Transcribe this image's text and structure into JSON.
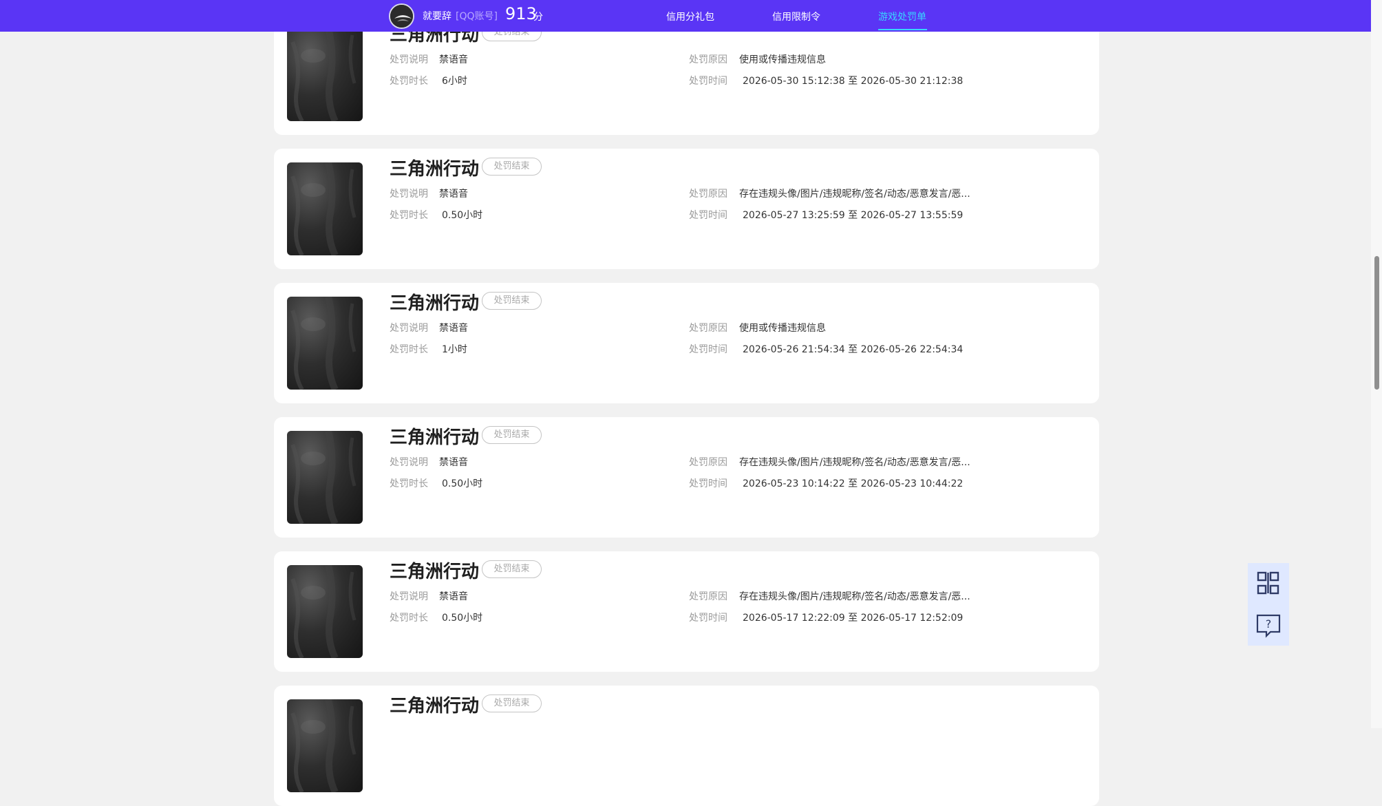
{
  "header": {
    "user_name": "就要辞",
    "account_tag": "[QQ账号]",
    "score": "913",
    "score_unit": "分",
    "avatar_icon": "user-avatar",
    "nav": [
      {
        "label": "信用分礼包",
        "active": false
      },
      {
        "label": "信用限制令",
        "active": false
      },
      {
        "label": "游戏处罚单",
        "active": true
      }
    ],
    "colors": {
      "bar": "#5a35f5",
      "active": "#38d6ff"
    }
  },
  "labels": {
    "desc": "处罚说明",
    "duration": "处罚时长",
    "reason": "处罚原因",
    "time": "处罚时间"
  },
  "records": [
    {
      "game": "三角洲行动",
      "status": "处罚结束",
      "desc": "禁语音",
      "duration": "6小时",
      "reason": "使用或传播违规信息",
      "time": "2026-05-30 15:12:38 至 2026-05-30 21:12:38"
    },
    {
      "game": "三角洲行动",
      "status": "处罚结束",
      "desc": "禁语音",
      "duration": "0.50小时",
      "reason": "存在违规头像/图片/违规昵称/签名/动态/恶意发言/恶...",
      "time": "2026-05-27 13:25:59 至 2026-05-27 13:55:59"
    },
    {
      "game": "三角洲行动",
      "status": "处罚结束",
      "desc": "禁语音",
      "duration": "1小时",
      "reason": "使用或传播违规信息",
      "time": "2026-05-26 21:54:34 至 2026-05-26 22:54:34"
    },
    {
      "game": "三角洲行动",
      "status": "处罚结束",
      "desc": "禁语音",
      "duration": "0.50小时",
      "reason": "存在违规头像/图片/违规昵称/签名/动态/恶意发言/恶...",
      "time": "2026-05-23 10:14:22 至 2026-05-23 10:44:22"
    },
    {
      "game": "三角洲行动",
      "status": "处罚结束",
      "desc": "禁语音",
      "duration": "0.50小时",
      "reason": "存在违规头像/图片/违规昵称/签名/动态/恶意发言/恶...",
      "time": "2026-05-17 12:22:09 至 2026-05-17 12:52:09"
    },
    {
      "game": "三角洲行动",
      "status": "处罚结束"
    }
  ],
  "float_buttons": [
    {
      "icon": "qr-code-icon"
    },
    {
      "icon": "help-chat-icon"
    }
  ]
}
